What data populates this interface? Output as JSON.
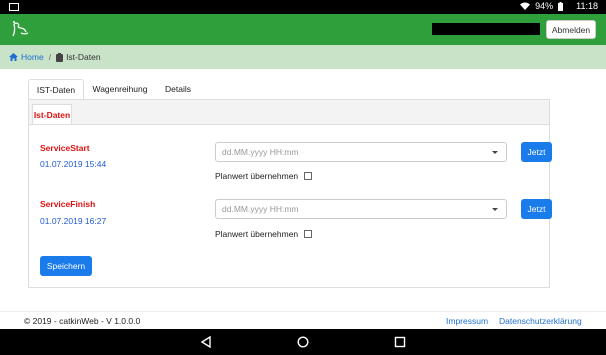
{
  "status_bar": {
    "battery": "94%",
    "time": "11:18",
    "icons": [
      "screenshot-icon",
      "wifi-icon",
      "battery-icon"
    ]
  },
  "header": {
    "logo": "catkin-logo-icon",
    "logout_label": "Abmelden"
  },
  "breadcrumb": {
    "home_label": "Home",
    "separator": "/",
    "current_label": "Ist-Daten"
  },
  "tabs": [
    {
      "label": "IST-Daten",
      "active": true
    },
    {
      "label": "Wagenreihung",
      "active": false
    },
    {
      "label": "Details",
      "active": false
    }
  ],
  "subtab": {
    "label": "Ist-Daten"
  },
  "service_start": {
    "label": "ServiceStart",
    "value": "01.07.2019 15:44",
    "input_placeholder": "dd.MM.yyyy HH:mm",
    "jetzt_label": "Jetzt",
    "planwert_label": "Planwert übernehmen",
    "planwert_checked": false
  },
  "service_finish": {
    "label": "ServiceFinish",
    "value": "01.07.2019 16:27",
    "input_placeholder": "dd.MM.yyyy HH:mm",
    "jetzt_label": "Jetzt",
    "planwert_label": "Planwert übernehmen",
    "planwert_checked": false
  },
  "save_label": "Speichern",
  "footer": {
    "copyright": "© 2019 - catkinWeb - V 1.0.0.0",
    "impressum": "Impressum",
    "datenschutz": "Datenschutzerklärung"
  },
  "colors": {
    "header_green": "#2e9f3b",
    "breadcrumb_bg": "#c9e3c9",
    "accent_blue": "#1a7bea",
    "label_red": "#d11111"
  }
}
